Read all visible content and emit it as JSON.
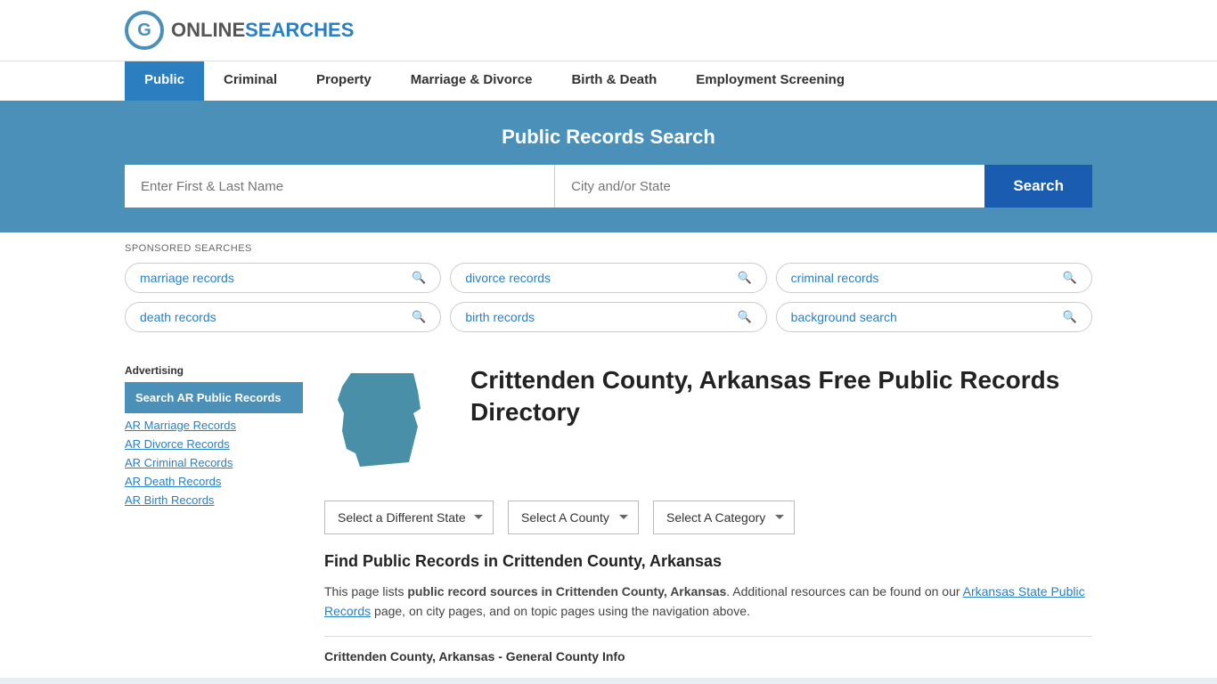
{
  "header": {
    "logo_online": "ONLINE",
    "logo_searches": "SEARCHES"
  },
  "nav": {
    "items": [
      {
        "label": "Public",
        "active": true
      },
      {
        "label": "Criminal",
        "active": false
      },
      {
        "label": "Property",
        "active": false
      },
      {
        "label": "Marriage & Divorce",
        "active": false
      },
      {
        "label": "Birth & Death",
        "active": false
      },
      {
        "label": "Employment Screening",
        "active": false
      }
    ]
  },
  "search_banner": {
    "title": "Public Records Search",
    "name_placeholder": "Enter First & Last Name",
    "location_placeholder": "City and/or State",
    "button_label": "Search"
  },
  "sponsored": {
    "label": "SPONSORED SEARCHES",
    "tags": [
      "marriage records",
      "divorce records",
      "criminal records",
      "death records",
      "birth records",
      "background search"
    ]
  },
  "page": {
    "title": "Crittenden County, Arkansas Free Public Records Directory",
    "state_name": "Arkansas"
  },
  "dropdowns": {
    "state_label": "Select a Different State",
    "county_label": "Select A County",
    "category_label": "Select A Category"
  },
  "find_section": {
    "title": "Find Public Records in Crittenden County, Arkansas",
    "desc_part1": "This page lists ",
    "desc_bold": "public record sources in Crittenden County, Arkansas",
    "desc_part2": ". Additional resources can be found on our ",
    "desc_link": "Arkansas State Public Records",
    "desc_part3": " page, on city pages, and on topic pages using the navigation above."
  },
  "general_info": {
    "label": "Crittenden County, Arkansas - General County Info"
  },
  "sidebar": {
    "ad_label": "Advertising",
    "ad_box_text": "Search AR Public Records",
    "links": [
      "AR Marriage Records",
      "AR Divorce Records",
      "AR Criminal Records",
      "AR Death Records",
      "AR Birth Records"
    ]
  }
}
